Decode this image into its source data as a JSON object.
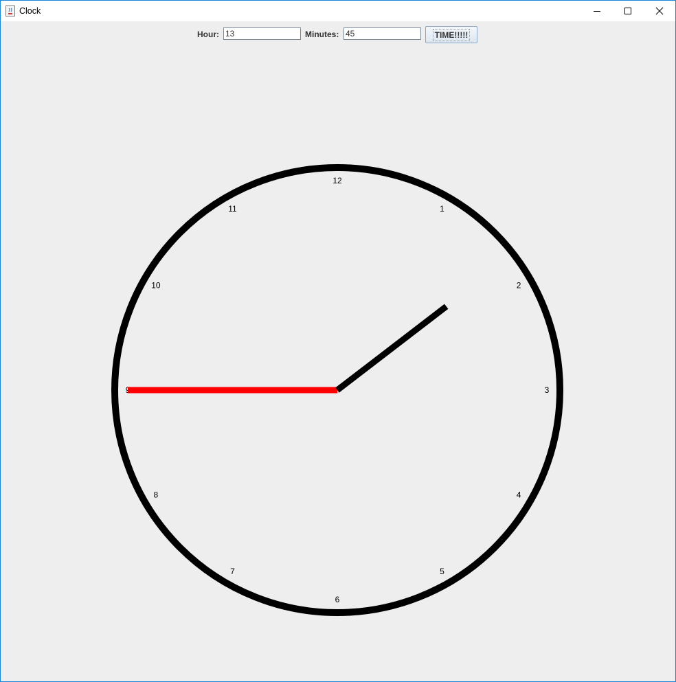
{
  "window": {
    "title": "Clock"
  },
  "controls": {
    "hour_label": "Hour:",
    "hour_value": "13",
    "minutes_label": "Minutes:",
    "minutes_value": "45",
    "time_button_label": "TIME!!!!!"
  },
  "clock": {
    "numbers": [
      "12",
      "1",
      "2",
      "3",
      "4",
      "5",
      "6",
      "7",
      "8",
      "9",
      "10",
      "11"
    ],
    "hour": 13,
    "minutes": 45,
    "hour_hand_color": "#000000",
    "minute_hand_color": "#ff0000",
    "face_color": "#000000"
  }
}
